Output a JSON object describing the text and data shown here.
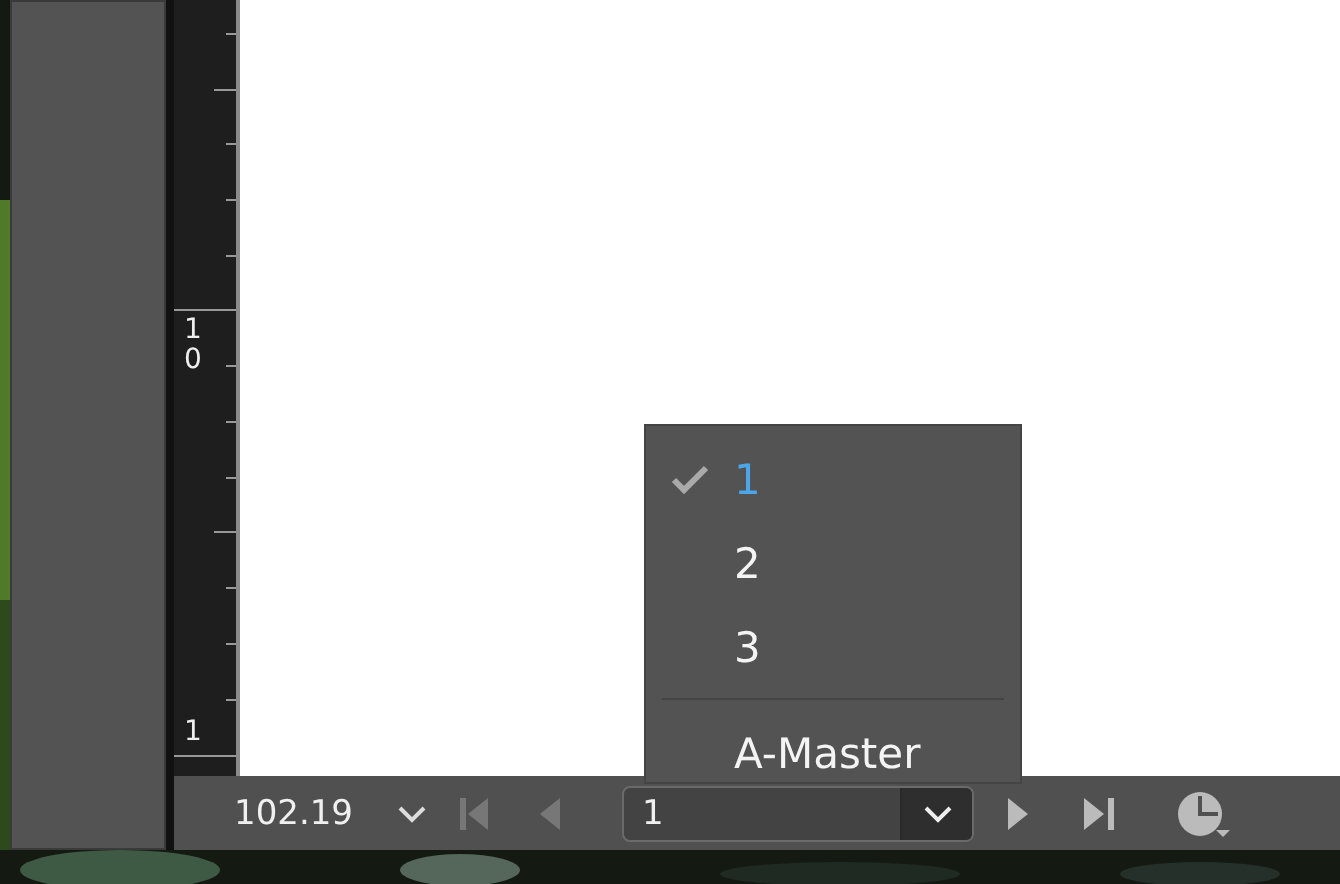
{
  "ruler": {
    "labels": [
      "10",
      "1"
    ]
  },
  "status_bar": {
    "zoom": "102.19",
    "first_page_disabled": true,
    "previous_page_disabled": true,
    "page": "1"
  },
  "page_menu": {
    "items": [
      {
        "label": "1",
        "selected": true
      },
      {
        "label": "2",
        "selected": false
      },
      {
        "label": "3",
        "selected": false
      },
      {
        "label": "A-Master",
        "selected": false,
        "separator_before": true
      }
    ]
  }
}
